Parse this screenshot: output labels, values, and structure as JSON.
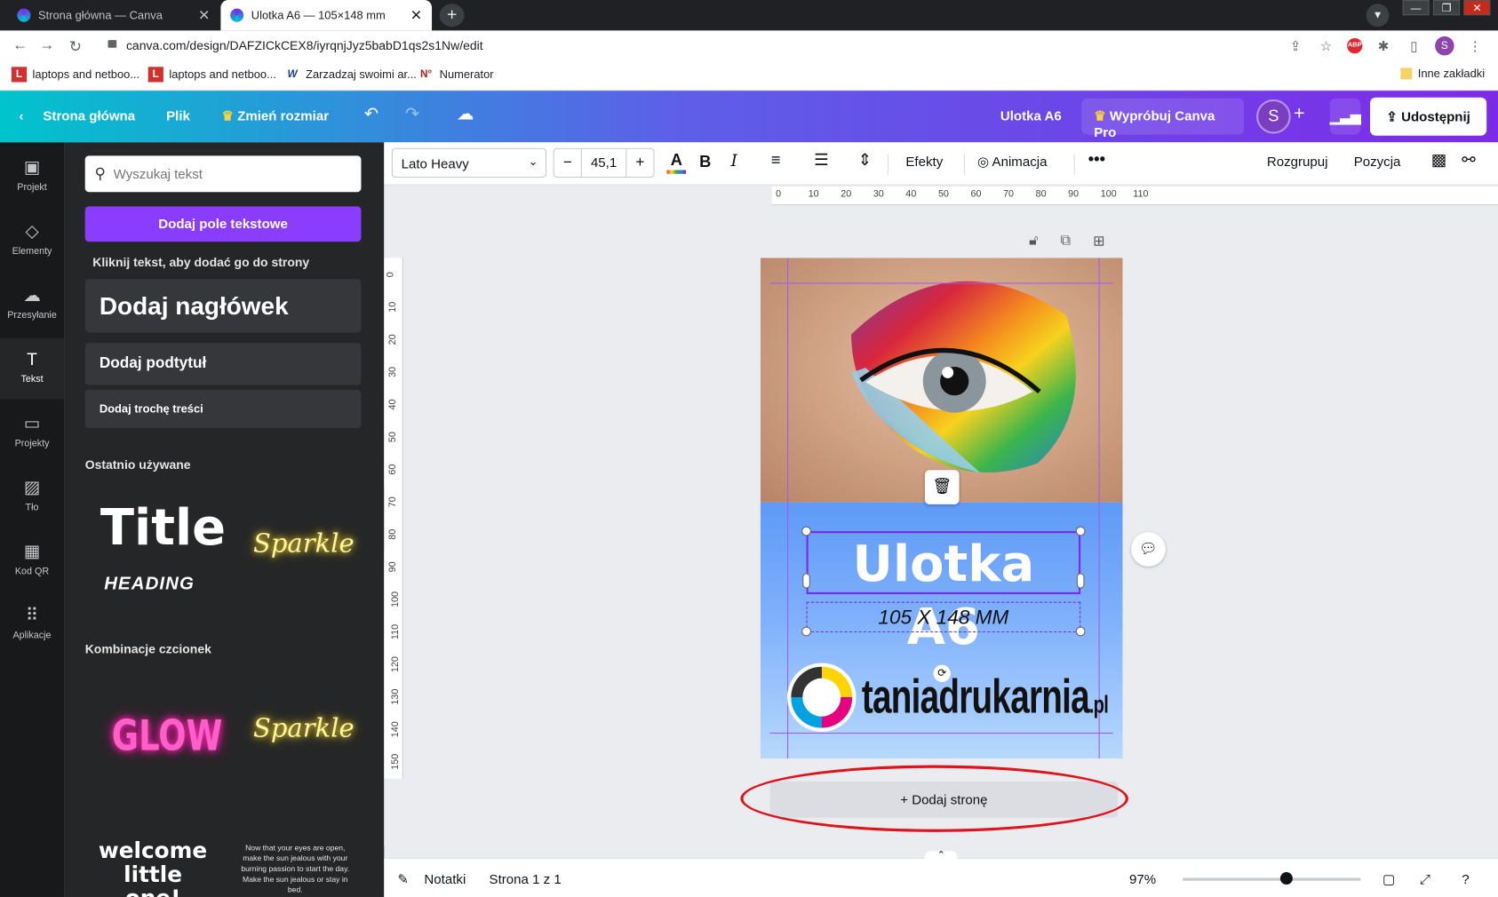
{
  "browser": {
    "tabs": [
      {
        "title": "Strona główna — Canva"
      },
      {
        "title": "Ulotka A6 — 105×148 mm"
      }
    ],
    "url": "canva.com/design/DAFZICkCEX8/iyrqnjJyz5babD1qs2s1Nw/edit",
    "bookmarks": [
      {
        "label": "laptops and netboo..."
      },
      {
        "label": "laptops and netboo..."
      },
      {
        "label": "Zarzadzaj swoimi ar..."
      },
      {
        "label": "Numerator"
      }
    ],
    "other_bookmarks": "Inne zakładki",
    "profile_initial": "S"
  },
  "header": {
    "home": "Strona główna",
    "file": "Plik",
    "resize": "Zmień rozmiar",
    "doc_title": "Ulotka A6",
    "try_pro": "Wypróbuj Canva Pro",
    "avatar": "S",
    "share": "Udostępnij"
  },
  "rail": [
    {
      "label": "Projekt",
      "icon": "layout-icon"
    },
    {
      "label": "Elementy",
      "icon": "shapes-icon"
    },
    {
      "label": "Przesyłanie",
      "icon": "cloud-upload-icon"
    },
    {
      "label": "Tekst",
      "icon": "text-icon"
    },
    {
      "label": "Projekty",
      "icon": "folder-icon"
    },
    {
      "label": "Tło",
      "icon": "background-icon"
    },
    {
      "label": "Kod QR",
      "icon": "qr-icon"
    },
    {
      "label": "Aplikacje",
      "icon": "apps-icon"
    }
  ],
  "panel": {
    "search_placeholder": "Wyszukaj tekst",
    "add_textbox": "Dodaj pole tekstowe",
    "hint": "Kliknij tekst, aby dodać go do strony",
    "add_heading": "Dodaj nagłówek",
    "add_subtitle": "Dodaj podtytuł",
    "add_body": "Dodaj trochę treści",
    "recent_title": "Ostatnio używane",
    "recent_title_sample": "Title",
    "recent_heading_sample": "HEADING",
    "sparkle": "Sparkle",
    "combos_title": "Kombinacje czcionek",
    "glow": "GLOW",
    "sparkle2": "Sparkle",
    "welcome": "welcome little one!",
    "quote": "Now that your eyes are open, make the sun jealous with your burning passion to start the day. Make the sun jealous or stay in bed."
  },
  "toolbar": {
    "font": "Lato Heavy",
    "size": "45,1",
    "effects": "Efekty",
    "animation": "Animacja",
    "ungroup": "Rozgrupuj",
    "position": "Pozycja"
  },
  "rulers": {
    "h": [
      "0",
      "10",
      "20",
      "30",
      "40",
      "50",
      "60",
      "70",
      "80",
      "90",
      "100",
      "110"
    ],
    "v": [
      "0",
      "10",
      "20",
      "30",
      "40",
      "50",
      "60",
      "70",
      "80",
      "90",
      "100",
      "110",
      "120",
      "130",
      "140",
      "150"
    ]
  },
  "page": {
    "title": "Ulotka A6",
    "subtitle": "105 X 148 MM",
    "logo": "taniadrukarnia",
    "logo_tld": ".pl"
  },
  "add_page": "+ Dodaj stronę",
  "bottom": {
    "notes": "Notatki",
    "page_info": "Strona 1 z 1",
    "zoom": "97%",
    "zoom_fraction": 0.58
  },
  "colors": {
    "accent": "#8b3dff",
    "annotation": "#e0121a"
  }
}
